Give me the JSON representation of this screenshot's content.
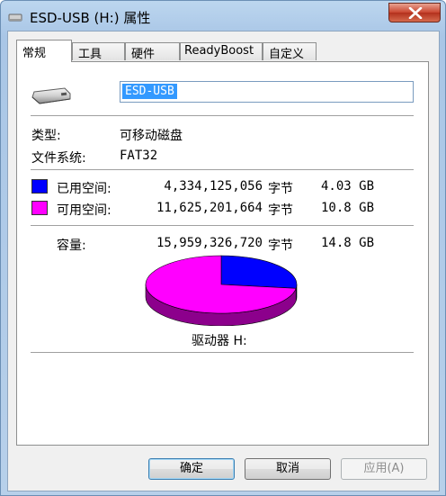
{
  "window": {
    "title": "ESD-USB (H:) 属性"
  },
  "tabs": [
    {
      "label": "常规"
    },
    {
      "label": "工具"
    },
    {
      "label": "硬件"
    },
    {
      "label": "ReadyBoost"
    },
    {
      "label": "自定义"
    }
  ],
  "general": {
    "drive_name": "ESD-USB",
    "type_label": "类型:",
    "type_value": "可移动磁盘",
    "fs_label": "文件系统:",
    "fs_value": "FAT32",
    "used": {
      "label": "已用空间:",
      "bytes": "4,334,125,056",
      "unit": "字节",
      "size": "4.03 GB",
      "color": "#0000ff"
    },
    "free": {
      "label": "可用空间:",
      "bytes": "11,625,201,664",
      "unit": "字节",
      "size": "10.8 GB",
      "color": "#ff00ff"
    },
    "capacity": {
      "label": "容量:",
      "bytes": "15,959,326,720",
      "unit": "字节",
      "size": "14.8 GB"
    },
    "drive_label": "驱动器 H:"
  },
  "chart_data": {
    "type": "pie",
    "categories": [
      "已用空间",
      "可用空间"
    ],
    "values": [
      4334125056,
      11625201664
    ],
    "colors": [
      "#0000ff",
      "#ff00ff"
    ]
  },
  "buttons": {
    "ok": "确定",
    "cancel": "取消",
    "apply": "应用(A)"
  }
}
